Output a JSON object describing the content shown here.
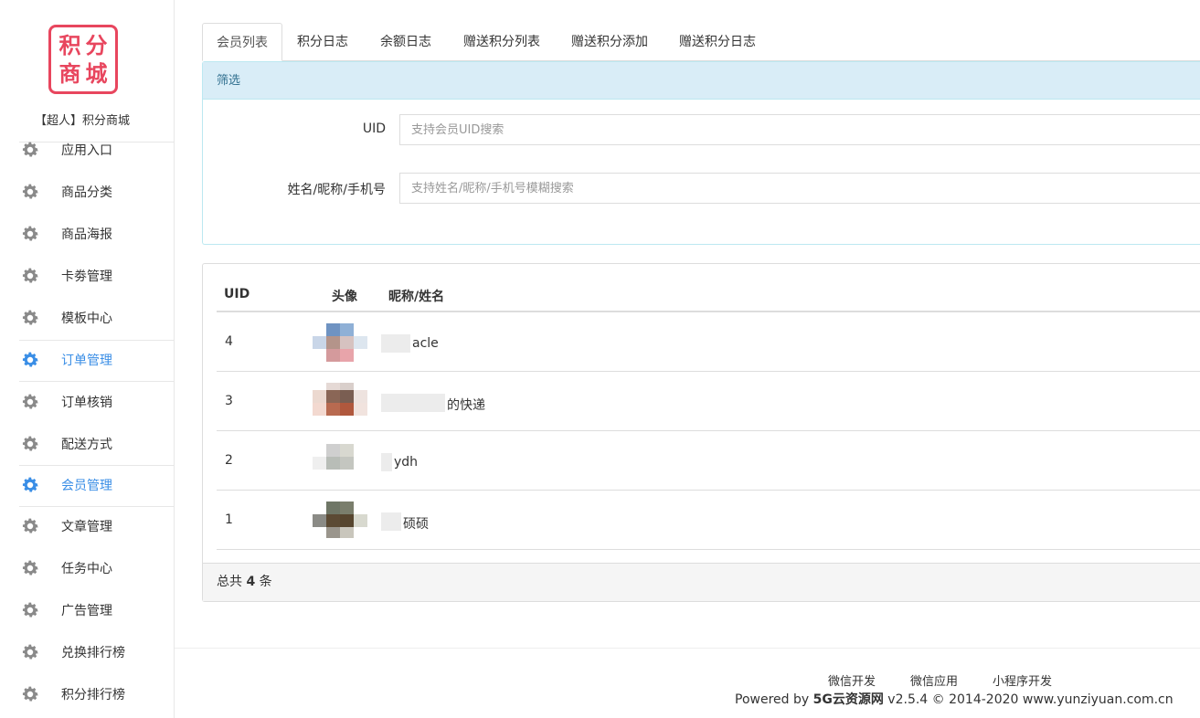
{
  "logo": {
    "chars": [
      "积",
      "分",
      "商",
      "城"
    ],
    "color": "#e8465e"
  },
  "site_name": "【超人】积分商城",
  "sidebar": {
    "items": [
      {
        "label": "应用入口",
        "icon": "gear-icon",
        "active": false
      },
      {
        "label": "商品分类",
        "icon": "gear-icon",
        "active": false
      },
      {
        "label": "商品海报",
        "icon": "gear-icon",
        "active": false
      },
      {
        "label": "卡劵管理",
        "icon": "gear-icon",
        "active": false
      },
      {
        "label": "模板中心",
        "icon": "gear-icon",
        "active": false
      },
      {
        "label": "订单管理",
        "icon": "gear-icon",
        "active": true
      },
      {
        "label": "订单核销",
        "icon": "gear-icon",
        "active": false
      },
      {
        "label": "配送方式",
        "icon": "gear-icon",
        "active": false
      },
      {
        "label": "会员管理",
        "icon": "gear-icon",
        "active": true
      },
      {
        "label": "文章管理",
        "icon": "gear-icon",
        "active": false
      },
      {
        "label": "任务中心",
        "icon": "gear-icon",
        "active": false
      },
      {
        "label": "广告管理",
        "icon": "gear-icon",
        "active": false
      },
      {
        "label": "兑换排行榜",
        "icon": "gear-icon",
        "active": false
      },
      {
        "label": "积分排行榜",
        "icon": "gear-icon",
        "active": false
      }
    ],
    "active_color": "#3a8ee6",
    "icon_color": "#888888"
  },
  "tabs": [
    {
      "label": "会员列表",
      "active": true
    },
    {
      "label": "积分日志",
      "active": false
    },
    {
      "label": "余额日志",
      "active": false
    },
    {
      "label": "赠送积分列表",
      "active": false
    },
    {
      "label": "赠送积分添加",
      "active": false
    },
    {
      "label": "赠送积分日志",
      "active": false
    }
  ],
  "filter": {
    "heading": "筛选",
    "uid_label": "UID",
    "uid_placeholder": "支持会员UID搜索",
    "name_label": "姓名/昵称/手机号",
    "name_placeholder": "支持姓名/昵称/手机号模糊搜索"
  },
  "table": {
    "headers": [
      "UID",
      "头像",
      "昵称/姓名"
    ],
    "rows": [
      {
        "uid": "4",
        "nickname": "acle"
      },
      {
        "uid": "3",
        "nickname": "的快递"
      },
      {
        "uid": "2",
        "nickname": "ydh"
      },
      {
        "uid": "1",
        "nickname": "硕硕"
      }
    ],
    "footer_prefix": "总共",
    "total": "4",
    "footer_suffix": "条"
  },
  "footer": {
    "links": [
      "微信开发",
      "微信应用",
      "小程序开发"
    ],
    "powered_prefix": "Powered by",
    "brand": "5G云资源网",
    "powered_suffix": "v2.5.4 © 2014-2020 www.yunziyuan.com.cn"
  }
}
